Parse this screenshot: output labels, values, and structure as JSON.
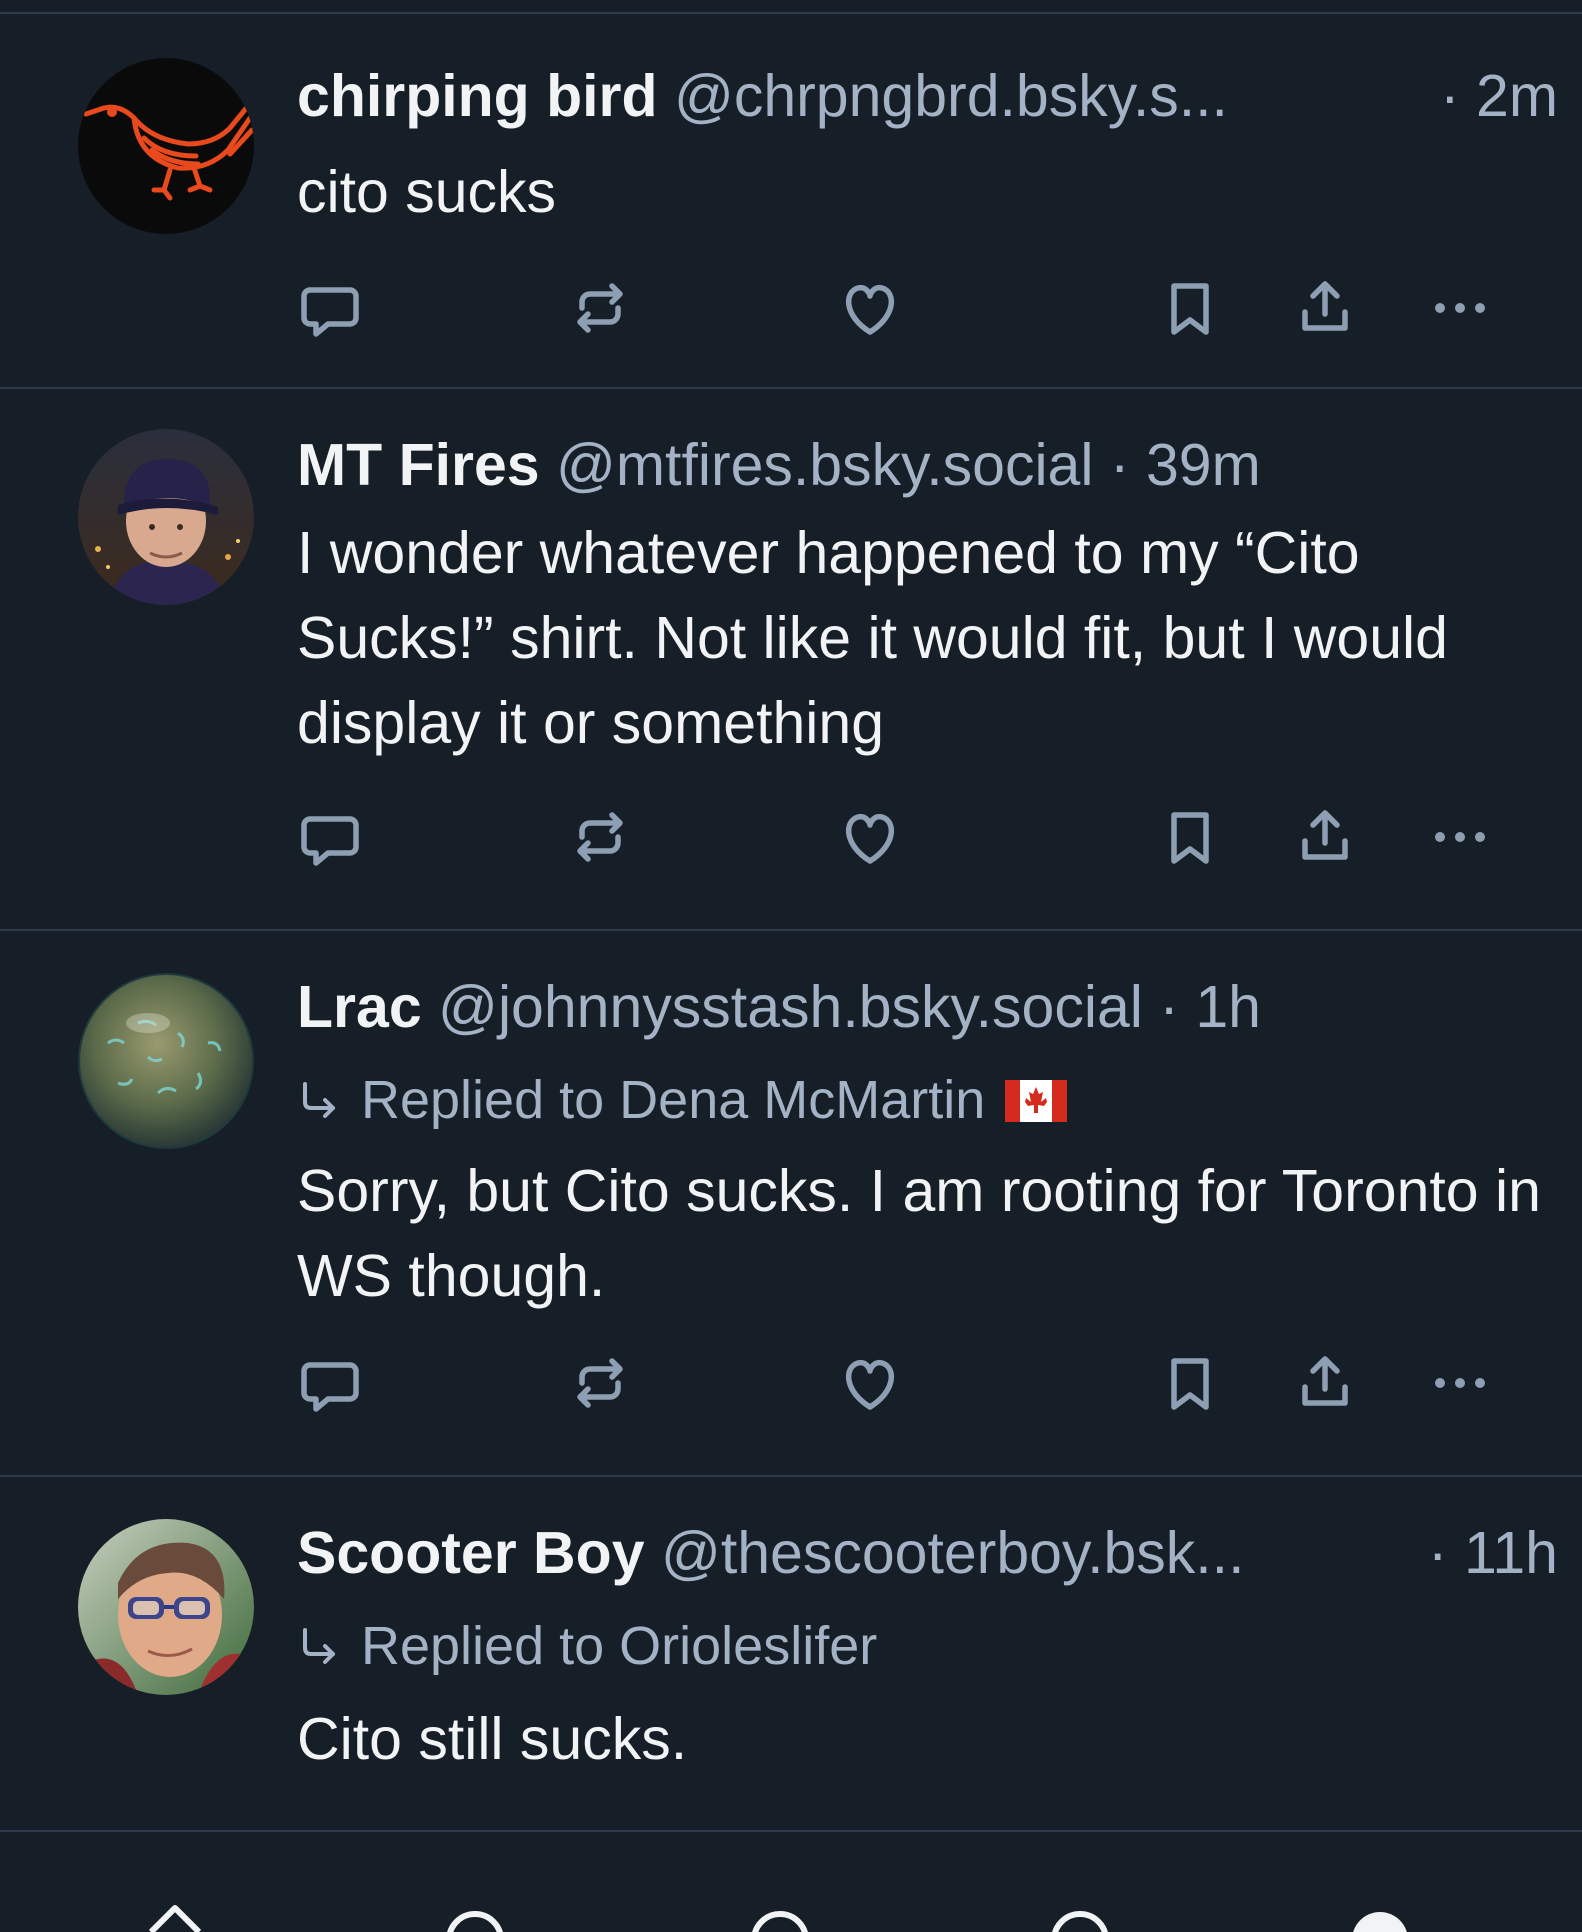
{
  "posts": [
    {
      "display_name": "chirping bird",
      "handle": "@chrpngbrd.bsky.s...",
      "sep": "·",
      "time": "2m",
      "reply_to": "",
      "text": "cito sucks",
      "avatar": "bird-logo"
    },
    {
      "display_name": "MT Fires",
      "handle": "@mtfires.bsky.social",
      "sep": "·",
      "time": "39m",
      "reply_to": "",
      "text": "I wonder whatever happened to my “Cito Sucks!” shirt.  Not like it would fit, but I would display it or something",
      "avatar": "person-cap"
    },
    {
      "display_name": "Lrac",
      "handle": "@johnnysstash.bsky.social",
      "sep": "·",
      "time": "1h",
      "reply_to": "Replied to Dena McMartin",
      "text": "Sorry, but Cito sucks.   I am rooting for Toronto in WS though.",
      "avatar": "glass-marble"
    },
    {
      "display_name": "Scooter Boy",
      "handle": "@thescooterboy.bsk...",
      "sep": "·",
      "time": "11h",
      "reply_to": "Replied to Orioleslifer",
      "text": "Cito still sucks.",
      "avatar": "person-glasses"
    }
  ],
  "icons": {
    "reply": "reply-icon",
    "repost": "repost-icon",
    "like": "heart-icon",
    "bookmark": "bookmark-icon",
    "share": "share-icon",
    "more": "more-icon",
    "reply_arrow": "reply-arrow-icon",
    "flag": "canada-flag-icon"
  },
  "colors": {
    "background": "#161e27",
    "text": "#f1f3f5",
    "muted": "#a3b2c4",
    "icon": "#8e9fb3",
    "divider": "#2e3a47",
    "bird_orange": "#e8491d"
  }
}
